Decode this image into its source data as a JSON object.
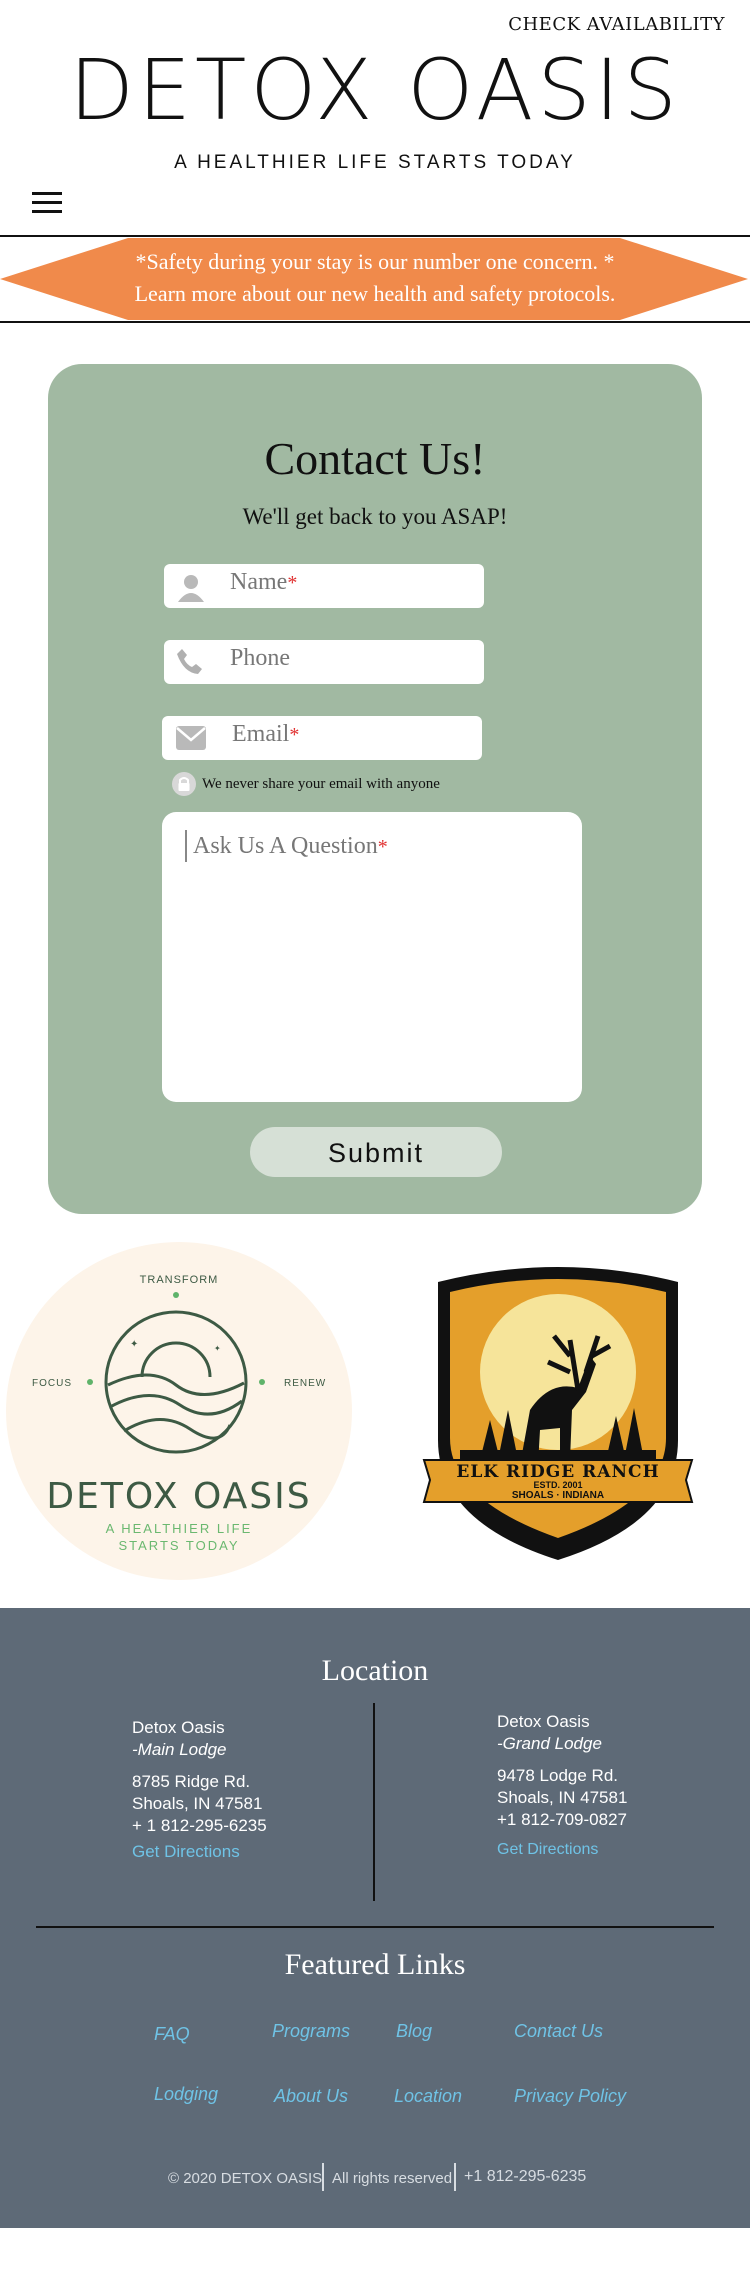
{
  "header": {
    "check_availability": "CHECK AVAILABILITY",
    "brand": "DETOX OASIS",
    "tagline": "A HEALTHIER LIFE STARTS TODAY",
    "menu_icon": "hamburger-icon"
  },
  "banner": {
    "line1": "*Safety during your stay is our number one concern. *",
    "line2": "Learn more about our new health and safety protocols.",
    "color": "#f08a4b"
  },
  "contact": {
    "title": "Contact Us!",
    "subtitle": "We'll get back to you ASAP!",
    "name_label": "Name",
    "phone_label": "Phone",
    "email_label": "Email",
    "required_mark": "*",
    "privacy_note": "We never share your email with anyone",
    "question_label": "Ask Us A Question",
    "submit_label": "Submit",
    "card_color": "#a1b9a2"
  },
  "logos": {
    "oasis": {
      "transform": "TRANSFORM",
      "focus": "FOCUS",
      "renew": "RENEW",
      "name": "DETOX OASIS",
      "tag1": "A HEALTHIER LIFE",
      "tag2": "STARTS TODAY"
    },
    "elk": {
      "name": "ELK RIDGE RANCH",
      "estd": "ESTD. 2001",
      "place": "SHOALS · INDIANA"
    }
  },
  "footer": {
    "location_title": "Location",
    "main": {
      "name": "Detox Oasis",
      "lodge": "-Main Lodge",
      "street": "8785 Ridge Rd.",
      "city": "Shoals, IN 47581",
      "phone": "+ 1 812-295-6235",
      "directions": "Get Directions"
    },
    "grand": {
      "name": "Detox Oasis",
      "lodge": "-Grand Lodge",
      "street": "9478 Lodge Rd.",
      "city": "Shoals, IN 47581",
      "phone": "+1 812-709-0827",
      "directions": "Get Directions"
    },
    "featured_title": "Featured Links",
    "links": [
      "FAQ",
      "Programs",
      "Blog",
      "Contact Us",
      "Lodging",
      "About Us",
      "Location",
      "Privacy Policy"
    ],
    "copyright": "© 2020 DETOX OASIS",
    "rights": "All rights reserved",
    "phone": "+1 812-295-6235",
    "bg_color": "#5e6a77",
    "link_color": "#6fc3e6"
  }
}
